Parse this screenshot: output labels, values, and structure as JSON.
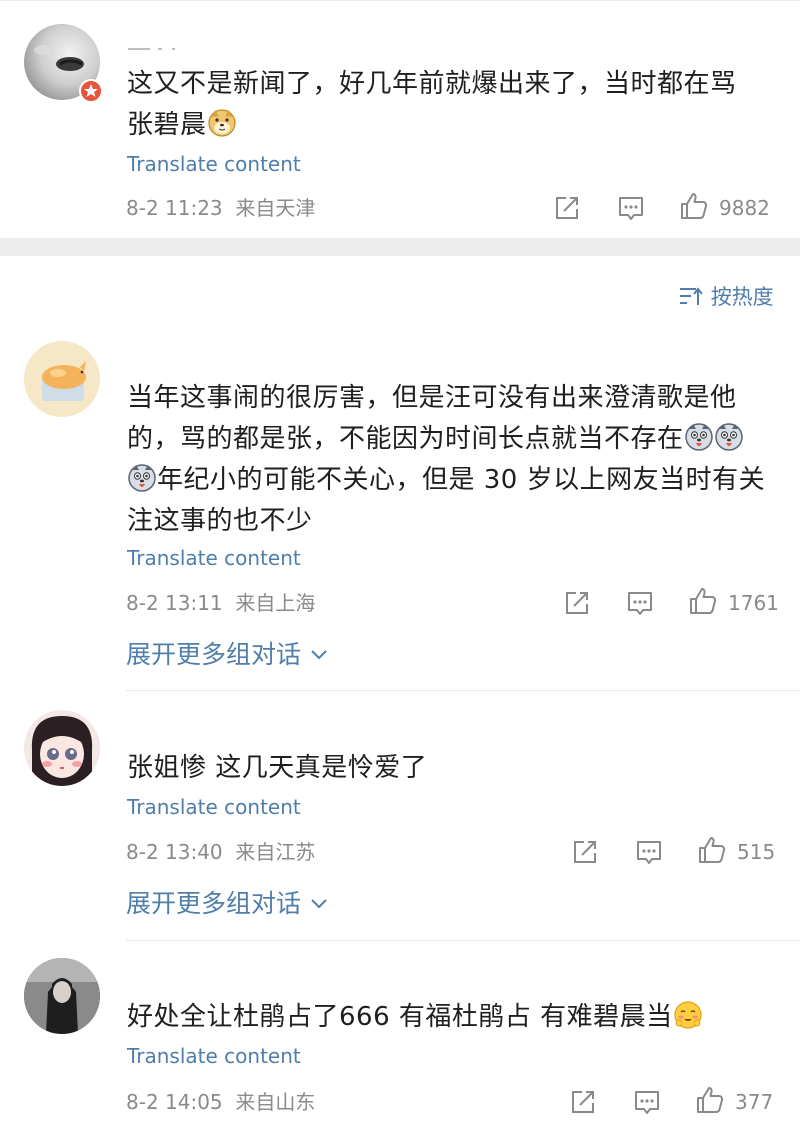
{
  "sort": {
    "label": "按热度"
  },
  "translate_label": "Translate content",
  "expand_label": "展开更多组对话",
  "comments": [
    {
      "text_line1": "这又不是新闻了，好几年前就爆出来了，当时都在骂",
      "text_line2": "张碧晨",
      "time": "8-2 11:23",
      "location": "来自天津",
      "likes": "9882"
    },
    {
      "text_line1": "当年这事闹的很厉害，但是汪可没有出来澄清歌是他",
      "text_line2": "的，骂的都是张，不能因为时间长点就当不存在",
      "text_line3": "年纪小的可能不关心，但是 30 岁以上网友当时有关",
      "text_line4": "注这事的也不少",
      "time": "8-2 13:11",
      "location": "来自上海",
      "likes": "1761"
    },
    {
      "text": "张姐惨 这几天真是怜爱了",
      "time": "8-2 13:40",
      "location": "来自江苏",
      "likes": "515"
    },
    {
      "text": "好处全让杜鹃占了666 有福杜鹃占 有难碧晨当",
      "time": "8-2 14:05",
      "location": "来自山东",
      "likes": "377"
    }
  ],
  "colors": {
    "link": "#4f7eab",
    "meta": "#8a8a8a",
    "separator": "#ececec",
    "badge": "#e8553f"
  },
  "icons": [
    "share-icon",
    "comment-icon",
    "thumbs-up-icon",
    "sort-icon",
    "chevron-down-icon",
    "doge-emoji",
    "husky-emoji",
    "blush-emoji",
    "vip-badge-icon"
  ]
}
